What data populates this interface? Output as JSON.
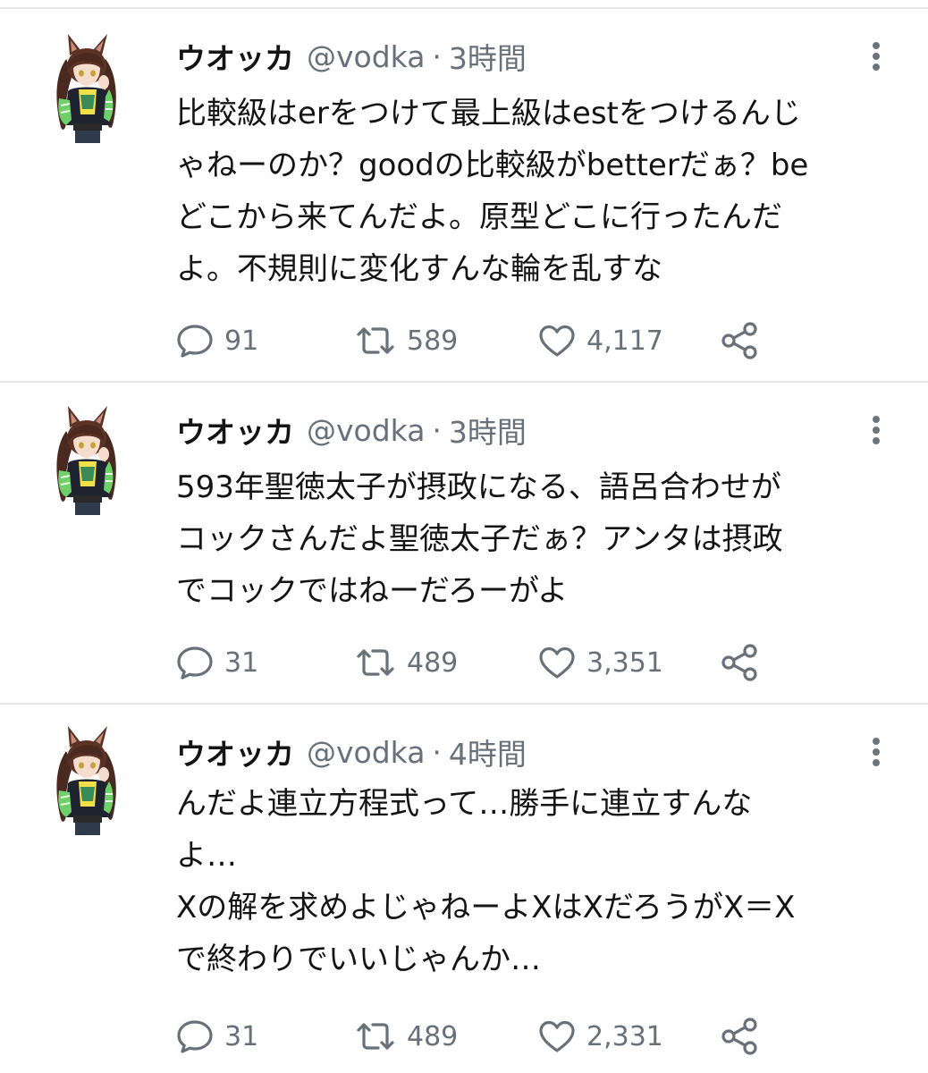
{
  "tweets": [
    {
      "name": "ウオッカ",
      "handle": "@vodka",
      "time": "3時間",
      "lines": [
        "比較級はerをつけて最上級はestをつけるんじ",
        "ゃねーのか？goodの比較級がbetterだぁ？be",
        "どこから来てんだよ。原型どこに行ったんだ",
        "よ。不規則に変化すんな輪を乱すな"
      ],
      "reply_count": "91",
      "retweet_count": "589",
      "like_count": "4,117"
    },
    {
      "name": "ウオッカ",
      "handle": "@vodka",
      "time": "3時間",
      "lines": [
        "593年聖徳太子が摂政になる、語呂合わせが",
        "コックさんだよ聖徳太子だぁ？アンタは摂政",
        "でコックではねーだろーがよ"
      ],
      "reply_count": "31",
      "retweet_count": "489",
      "like_count": "3,351"
    },
    {
      "name": "ウオッカ",
      "handle": "@vodka",
      "time": "4時間",
      "lines": [
        "んだよ連立方程式って…勝手に連立すんな",
        "よ…",
        "Xの解を求めよじゃねーよXはXだろうがX＝X",
        "で終わりでいいじゃんか…"
      ],
      "reply_count": "31",
      "retweet_count": "489",
      "like_count": "2,331"
    }
  ],
  "separator": "·",
  "icons": {
    "reply": "speech-bubble-icon",
    "retweet": "retweet-arrows-icon",
    "like": "heart-icon",
    "share": "share-nodes-icon",
    "menu": "vertical-ellipsis-icon",
    "avatar": "horse-girl-character-avatar"
  },
  "colors": {
    "text": "#141414",
    "muted": "#68717a",
    "divider": "#e6e6e6",
    "icon": "#68717a"
  }
}
